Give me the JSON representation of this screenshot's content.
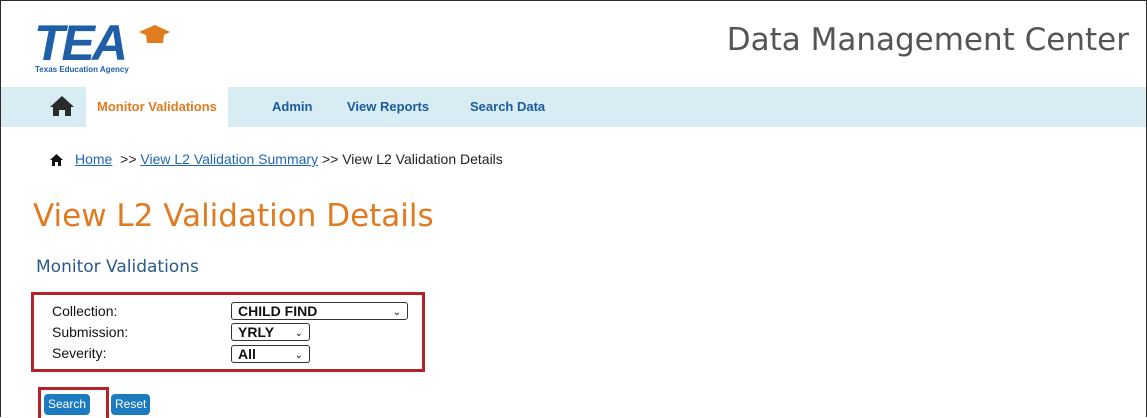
{
  "brand": {
    "logo_text": "TEA",
    "logo_subtitle": "Texas Education Agency",
    "logo_color": "#1f5fa8",
    "cap_color": "#e07b20",
    "app_title": "Data Management Center"
  },
  "nav": {
    "home_icon": "home-icon",
    "items": [
      {
        "label": "Monitor Validations",
        "active": true
      },
      {
        "label": "Admin",
        "active": false
      },
      {
        "label": "View Reports",
        "active": false
      },
      {
        "label": "Search Data",
        "active": false
      }
    ]
  },
  "breadcrumb": {
    "home": "Home",
    "sep1": ">>",
    "summary": "View L2 Validation Summary",
    "sep2": ">>",
    "current": "View L2 Validation Details"
  },
  "page": {
    "title": "View L2 Validation Details",
    "section": "Monitor Validations"
  },
  "filters": {
    "collection_label": "Collection:",
    "collection_value": "CHILD FIND",
    "submission_label": "Submission:",
    "submission_value": "YRLY",
    "severity_label": "Severity:",
    "severity_value": "All"
  },
  "buttons": {
    "search": "Search",
    "reset": "Reset"
  },
  "colors": {
    "accent_orange": "#e07b20",
    "nav_bg": "#d8ecf3",
    "link_blue": "#1f66b7",
    "button_blue": "#1b7ac0",
    "highlight_red": "#b5222a"
  }
}
